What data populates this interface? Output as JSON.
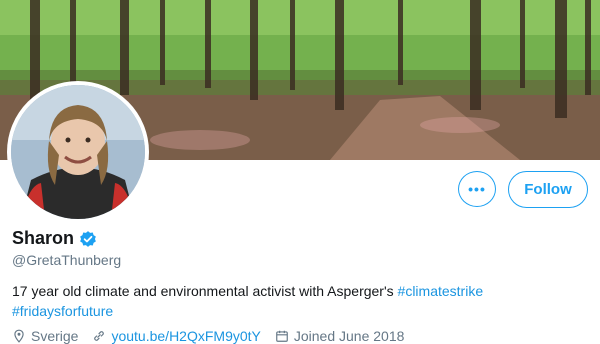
{
  "profile": {
    "name": "Sharon",
    "handle": "@GretaThunberg",
    "bio_text": "17 year old climate and environmental activist with Asperger's ",
    "bio_tags": [
      "#climatestrike",
      "#fridaysforfuture"
    ],
    "location": "Sverige",
    "website": "youtu.be/H2QxFM9y0tY",
    "joined": "Joined June 2018"
  },
  "actions": {
    "more_label": "•••",
    "follow_label": "Follow"
  },
  "colors": {
    "accent": "#1da1f2",
    "link": "#1b95e0",
    "muted": "#657786"
  },
  "icons": {
    "verified": "verified-badge-icon",
    "location": "location-pin-icon",
    "link": "link-icon",
    "calendar": "calendar-icon"
  }
}
